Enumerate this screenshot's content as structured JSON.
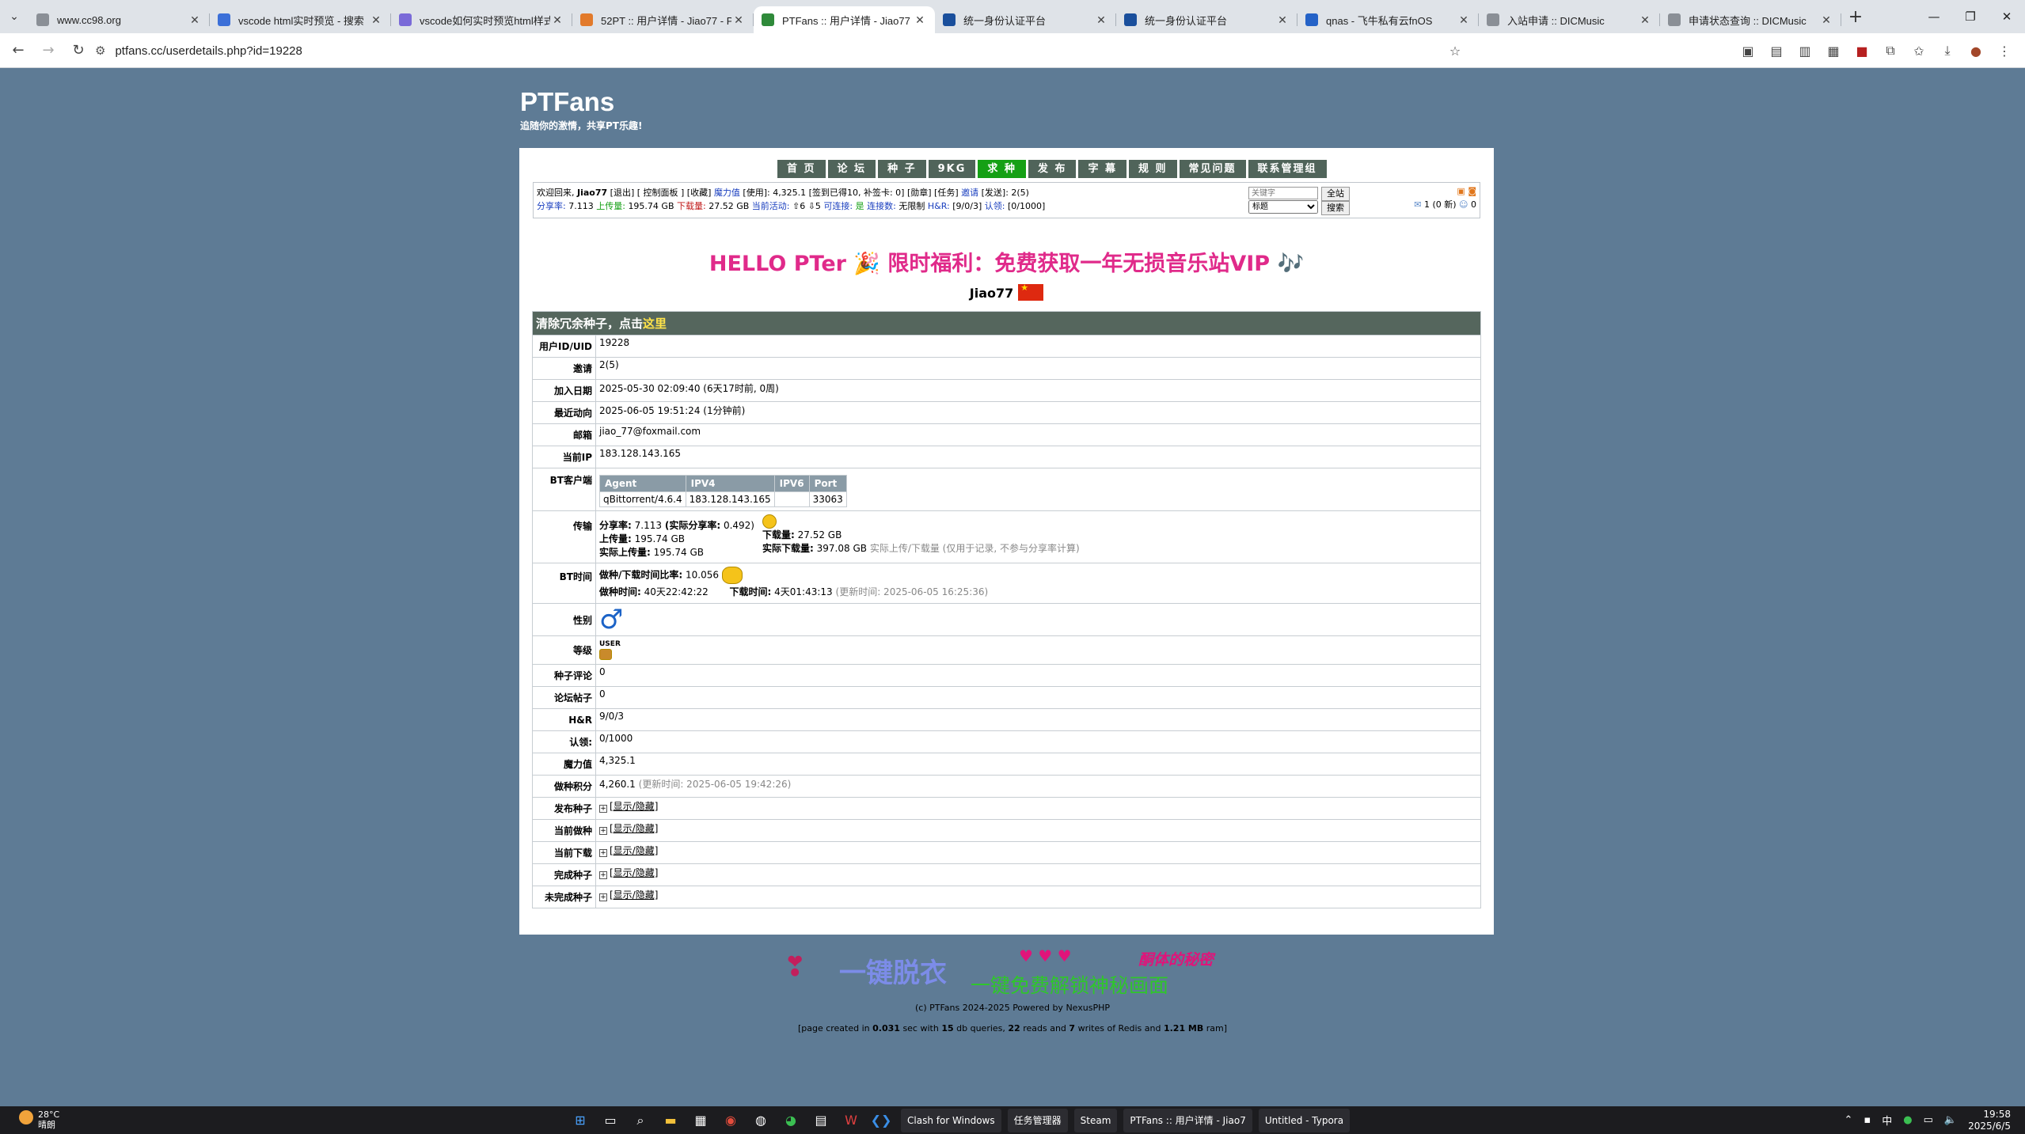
{
  "browser": {
    "tabs": [
      {
        "title": "www.cc98.org",
        "color": "#8a8f96"
      },
      {
        "title": "vscode html实时预览 - 搜索",
        "color": "#3b6fd8"
      },
      {
        "title": "vscode如何实时预览html样式",
        "color": "#7a6ad8"
      },
      {
        "title": "52PT :: 用户详情 - Jiao77 - P",
        "color": "#e27a2b"
      },
      {
        "title": "PTFans :: 用户详情 - Jiao77",
        "color": "#2f8a3a",
        "active": true
      },
      {
        "title": "统一身份认证平台",
        "color": "#1a4f9c"
      },
      {
        "title": "统一身份认证平台",
        "color": "#1a4f9c"
      },
      {
        "title": "qnas - 飞牛私有云fnOS",
        "color": "#2462c7"
      },
      {
        "title": "入站申请 :: DICMusic",
        "color": "#8a8f96"
      },
      {
        "title": "申请状态查询 :: DICMusic",
        "color": "#8a8f96"
      }
    ],
    "url": "ptfans.cc/userdetails.php?id=19228"
  },
  "site": {
    "name": "PTFans",
    "slogan": "追随你的激情，共享PT乐趣!"
  },
  "menu": [
    "首 页",
    "论 坛",
    "种 子",
    "9KG",
    "求 种",
    "发 布",
    "字 幕",
    "规 则",
    "常见问题",
    "联系管理组"
  ],
  "infobar": {
    "line1_prefix": "欢迎回来,",
    "username": "Jiao77",
    "line1_mid": "[退出] [ 控制面板 ] [收藏]",
    "magic_label": "魔力值",
    "line1_rest": "[使用]: 4,325.1 [签到已得10, 补签卡: 0] [勋章] [任务]",
    "invite_label": "邀请",
    "line1_end": "[发送]: 2(5)",
    "ratio_label": "分享率:",
    "ratio": "7.113",
    "up_label": "上传量:",
    "uploaded": "195.74 GB",
    "down_label": "下载量:",
    "downloaded": "27.52 GB",
    "active_label": "当前活动:",
    "active": "⇧6 ⇩5",
    "connectable_label": "可连接:",
    "connectable": "是",
    "conn_count_label": "连接数:",
    "conn_count": "无限制",
    "hr_label": "H&R:",
    "hr": "[9/0/3]",
    "claim_label": "认领:",
    "claim": "[0/1000]",
    "search_placeholder": "关键字",
    "search_scope": "标题",
    "btn_all": "全站",
    "btn_search": "搜索",
    "messages": "1 (0 新)",
    "friends": "0"
  },
  "hello_banner": "HELLO PTer 🎉 限时福利：免费获取一年无损音乐站VIP 🎶",
  "profile": {
    "username": "Jiao77",
    "clear_prefix": "清除冗余种子，点击",
    "clear_link": "这里",
    "rows": {
      "uid": {
        "label": "用户ID/UID",
        "value": "19228"
      },
      "invites": {
        "label": "邀请",
        "value": "2(5)"
      },
      "joined": {
        "label": "加入日期",
        "value": "2025-05-30 02:09:40 (6天17时前, 0周)"
      },
      "last_action": {
        "label": "最近动向",
        "value": "2025-06-05 19:51:24 (1分钟前)"
      },
      "email": {
        "label": "邮箱",
        "value": "jiao_77@foxmail.com"
      },
      "ip": {
        "label": "当前IP",
        "value": "183.128.143.165"
      },
      "bt_client": {
        "label": "BT客户端"
      },
      "transfer": {
        "label": "传输"
      },
      "bt_time": {
        "label": "BT时间"
      },
      "gender": {
        "label": "性别"
      },
      "class": {
        "label": "等级",
        "value": "USER"
      },
      "torrent_comments": {
        "label": "种子评论",
        "value": "0"
      },
      "forum_posts": {
        "label": "论坛帖子",
        "value": "0"
      },
      "hr": {
        "label": "H&R",
        "value": "9/0/3"
      },
      "claim": {
        "label": "认领:",
        "value": "0/1000"
      },
      "bonus": {
        "label": "魔力值",
        "value": "4,325.1"
      },
      "seed_points": {
        "label": "做种积分",
        "value": "4,260.1",
        "note": "(更新时间: 2025-06-05 19:42:26)"
      },
      "uploaded_torrents": {
        "label": "发布种子"
      },
      "seeding": {
        "label": "当前做种"
      },
      "leeching": {
        "label": "当前下载"
      },
      "completed": {
        "label": "完成种子"
      },
      "incomplete": {
        "label": "未完成种子"
      }
    },
    "toggle_label": "[显示/隐藏]",
    "client_table": {
      "headers": [
        "Agent",
        "IPV4",
        "IPV6",
        "Port"
      ],
      "row": [
        "qBittorrent/4.6.4",
        "183.128.143.165",
        "",
        "33063"
      ]
    },
    "transfer": {
      "ratio_label": "分享率:",
      "ratio": "7.113",
      "real_ratio_label": "(实际分享率:",
      "real_ratio": "0.492)",
      "up_label": "上传量:",
      "up": "195.74 GB",
      "down_label": "下载量:",
      "down": "27.52 GB",
      "real_up_label": "实际上传量:",
      "real_up": "195.74 GB",
      "real_down_label": "实际下载量:",
      "real_down": "397.08 GB",
      "real_note": "实际上传/下载量 (仅用于记录, 不参与分享率计算)"
    },
    "bt_time": {
      "ratio_label": "做种/下载时间比率:",
      "ratio": "10.056",
      "seed_label": "做种时间:",
      "seed": "40天22:42:22",
      "down_label": "下载时间:",
      "down": "4天01:43:13",
      "note": "(更新时间: 2025-06-05 16:25:36)"
    }
  },
  "footer": {
    "ad_text1": "一键脱衣",
    "ad_text2": "一键免费解锁神秘画面",
    "ad_text3": "酮体的秘密",
    "copyright": "(c) PTFans 2024-2025 Powered by NexusPHP",
    "stats_prefix": "[page created in",
    "time": "0.031",
    "sec_with": "sec with",
    "queries": "15",
    "db_queries": "db queries,",
    "reads": "22",
    "reads_and": "reads and",
    "writes": "7",
    "writes_of": "writes of Redis and",
    "ram": "1.21 MB",
    "ram_suffix": "ram]"
  },
  "taskbar": {
    "temp": "28°C",
    "weather": "晴朗",
    "apps": [
      "Clash for Windows",
      "任务管理器",
      "Steam",
      "PTFans :: 用户详情 - Jiao7",
      "Untitled - Typora"
    ],
    "ime": "中",
    "time": "19:58",
    "date": "2025/6/5"
  }
}
